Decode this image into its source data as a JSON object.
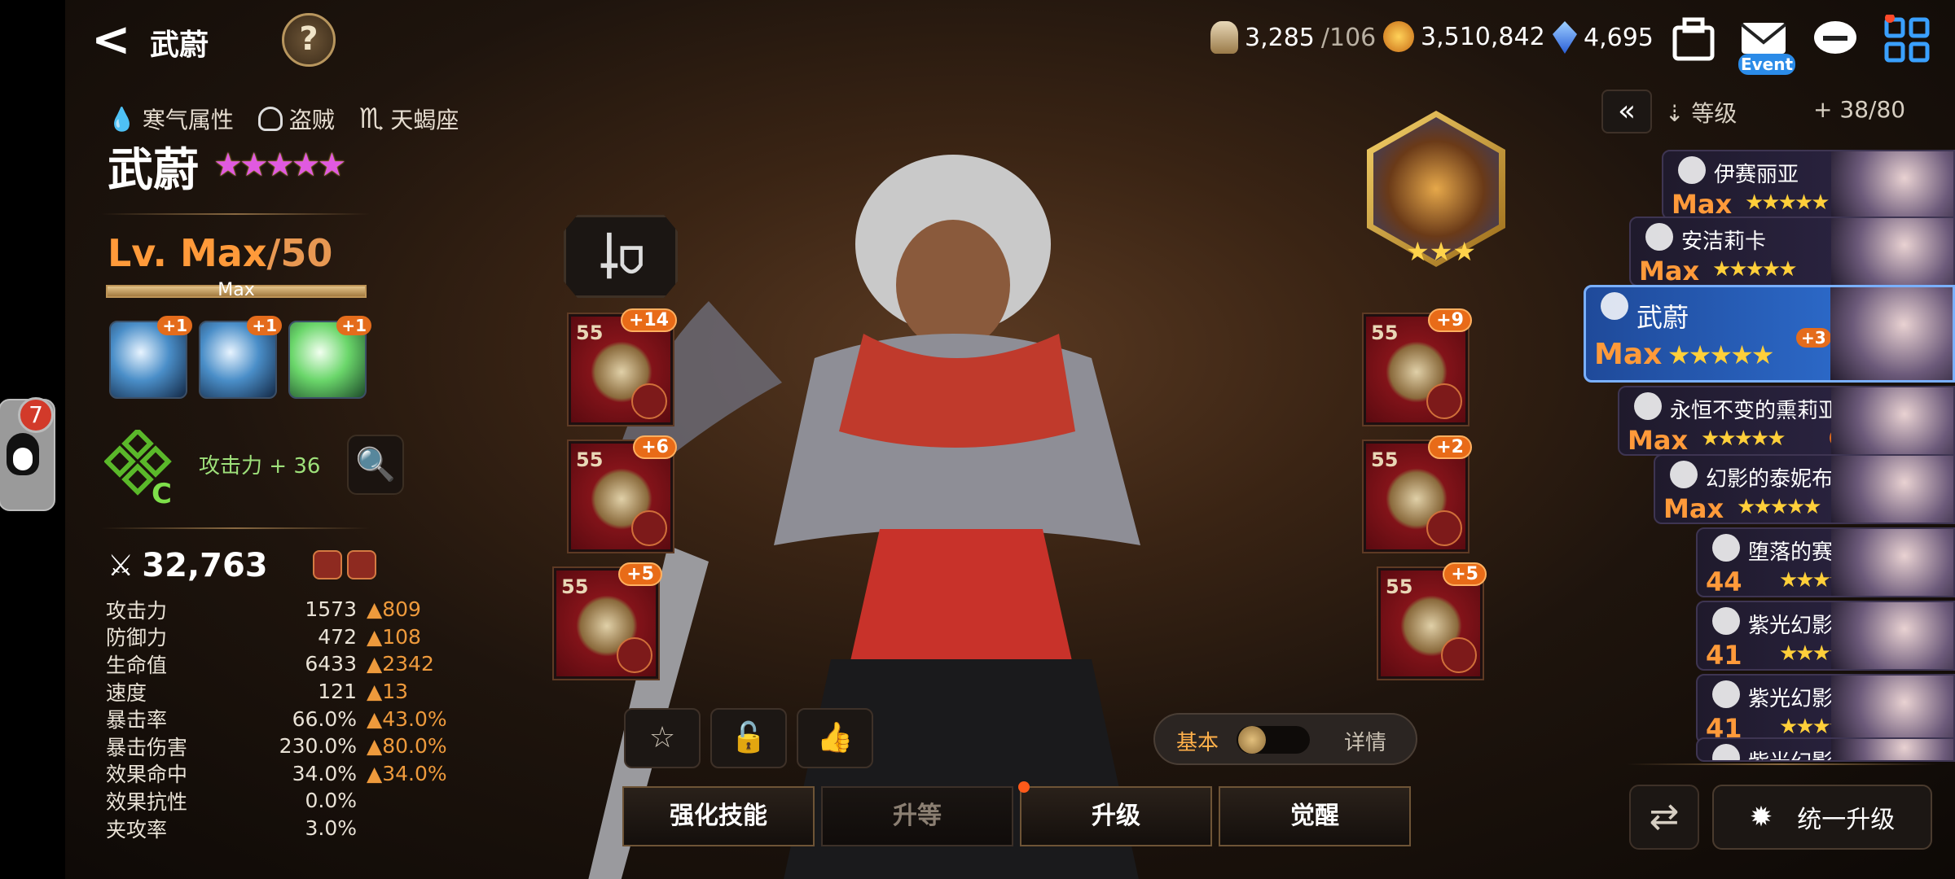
{
  "top": {
    "back_icon": "back-arrow-icon",
    "title": "武蔚",
    "help": "?",
    "stamina": "3,285",
    "stamina_cap": "/106",
    "gold": "3,510,842",
    "crystal": "4,695",
    "event_label": "Event"
  },
  "floating": {
    "qq_badge": "7"
  },
  "hero": {
    "attribute": "寒气属性",
    "class": "盗贼",
    "zodiac_symbol": "♏",
    "zodiac": "天蝎座",
    "name": "武蔚",
    "stars": "★★★★★",
    "level": "Lv. Max",
    "level_cap": "/50",
    "level_bar_label": "Max",
    "level_progress": 1.0,
    "skills": [
      {
        "name": "skill-1",
        "plus": "+1"
      },
      {
        "name": "skill-2",
        "plus": "+1"
      },
      {
        "name": "skill-3",
        "plus": "+1"
      }
    ],
    "rune_grade": "C",
    "rune_bonus": "攻击力 + 36",
    "combat_power": "32,763",
    "stats": [
      {
        "k": "攻击力",
        "v": "1573",
        "b": "809"
      },
      {
        "k": "防御力",
        "v": "472",
        "b": "108"
      },
      {
        "k": "生命值",
        "v": "6433",
        "b": "2342"
      },
      {
        "k": "速度",
        "v": "121",
        "b": "13"
      },
      {
        "k": "暴击率",
        "v": "66.0%",
        "b": "43.0%"
      },
      {
        "k": "暴击伤害",
        "v": "230.0%",
        "b": "80.0%"
      },
      {
        "k": "效果命中",
        "v": "34.0%",
        "b": "34.0%"
      },
      {
        "k": "效果抗性",
        "v": "0.0%",
        "b": ""
      },
      {
        "k": "夹攻率",
        "v": "3.0%",
        "b": ""
      }
    ]
  },
  "equipment": {
    "left": [
      {
        "lvl": "55",
        "enh": "+14"
      },
      {
        "lvl": "55",
        "enh": "+6"
      },
      {
        "lvl": "55",
        "enh": "+5"
      }
    ],
    "right": [
      {
        "lvl": "55",
        "enh": "+9"
      },
      {
        "lvl": "55",
        "enh": "+2"
      },
      {
        "lvl": "55",
        "enh": "+5"
      }
    ],
    "artifact_stars": "★★★"
  },
  "toggle": {
    "basic": "基本",
    "detail": "详情"
  },
  "tabs": [
    "强化技能",
    "升等",
    "升级",
    "觉醒"
  ],
  "roster": {
    "sort_label": "等级",
    "count": "38/80",
    "heroes": [
      {
        "name": "伊赛丽亚",
        "lvl": "Max",
        "stars": "★★★★★"
      },
      {
        "name": "安洁莉卡",
        "lvl": "Max",
        "stars": "★★★★★"
      },
      {
        "name": "武蔚",
        "lvl": "Max",
        "stars": "★★★★★",
        "plus": "+3"
      },
      {
        "name": "永恒不变的熏莉亚",
        "lvl": "Max",
        "stars": "★★★★★",
        "plus": "+15"
      },
      {
        "name": "幻影的泰妮布里雅",
        "lvl": "Max",
        "stars": "★★★★★"
      },
      {
        "name": "堕落的赛西莉亚",
        "lvl": "44",
        "stars": "★★★★★"
      },
      {
        "name": "紫光幻影",
        "lvl": "41",
        "stars": "★★★★★"
      },
      {
        "name": "紫光幻影",
        "lvl": "41",
        "stars": "★★★★★"
      },
      {
        "name": "紫光幻影",
        "lvl": "",
        "stars": ""
      }
    ],
    "unify_label": "统一升级"
  },
  "colors": {
    "accent_orange": "#ff9a3a",
    "selected_blue": "#2c69c8",
    "bonus": "#ee9a3c"
  }
}
